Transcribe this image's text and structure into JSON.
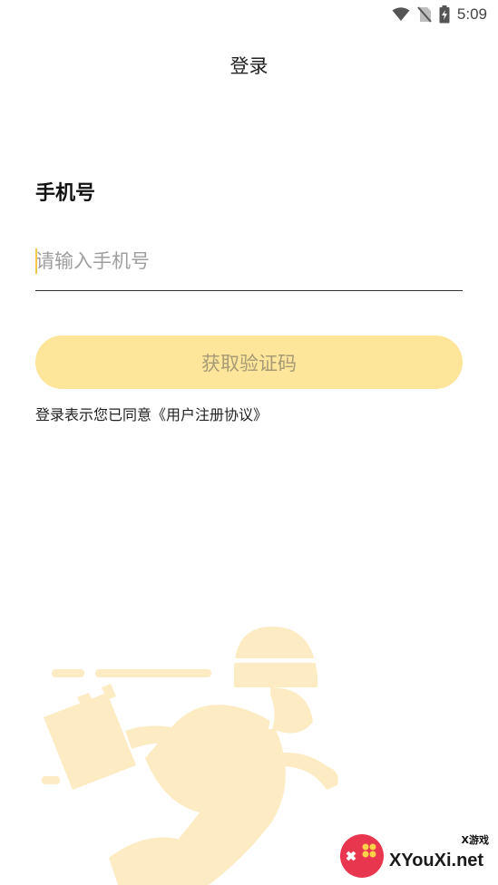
{
  "status_bar": {
    "time": "5:09",
    "icons": [
      "wifi-icon",
      "no-sim-icon",
      "battery-charging-icon"
    ]
  },
  "header": {
    "title": "登录"
  },
  "form": {
    "phone_label": "手机号",
    "phone_placeholder": "请输入手机号",
    "phone_value": "",
    "get_code_label": "获取验证码"
  },
  "agreement": {
    "text": "登录表示您已同意",
    "link": "《用户注册协议》"
  },
  "watermark": {
    "brand": "XYouXi.net",
    "subtext": "X游戏"
  },
  "colors": {
    "accent": "#fde59a",
    "button_text": "#a79a75",
    "illustration": "#fdebc3",
    "caret": "#f3c94a"
  }
}
